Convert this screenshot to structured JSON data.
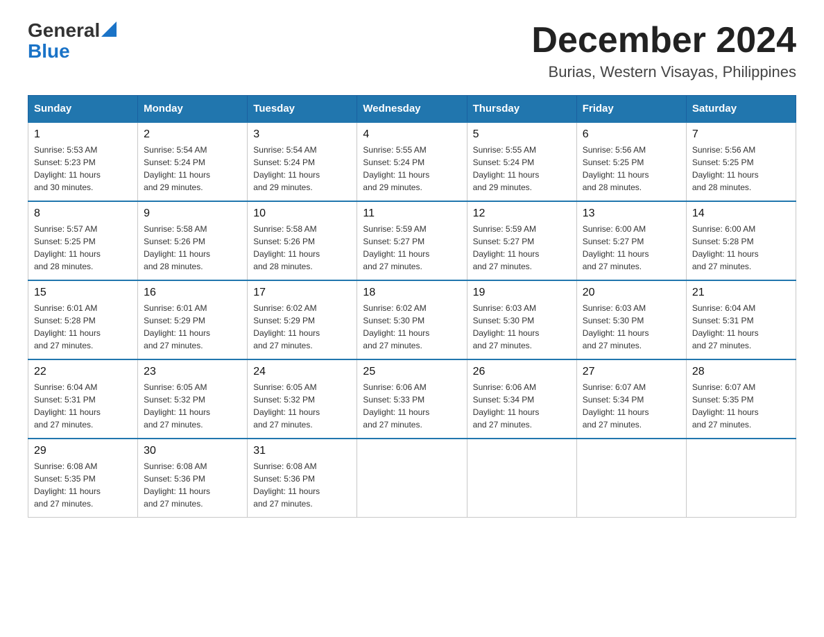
{
  "logo": {
    "general": "General",
    "blue": "Blue"
  },
  "header": {
    "month_year": "December 2024",
    "location": "Burias, Western Visayas, Philippines"
  },
  "days_of_week": [
    "Sunday",
    "Monday",
    "Tuesday",
    "Wednesday",
    "Thursday",
    "Friday",
    "Saturday"
  ],
  "weeks": [
    [
      {
        "day": "1",
        "info": "Sunrise: 5:53 AM\nSunset: 5:23 PM\nDaylight: 11 hours\nand 30 minutes."
      },
      {
        "day": "2",
        "info": "Sunrise: 5:54 AM\nSunset: 5:24 PM\nDaylight: 11 hours\nand 29 minutes."
      },
      {
        "day": "3",
        "info": "Sunrise: 5:54 AM\nSunset: 5:24 PM\nDaylight: 11 hours\nand 29 minutes."
      },
      {
        "day": "4",
        "info": "Sunrise: 5:55 AM\nSunset: 5:24 PM\nDaylight: 11 hours\nand 29 minutes."
      },
      {
        "day": "5",
        "info": "Sunrise: 5:55 AM\nSunset: 5:24 PM\nDaylight: 11 hours\nand 29 minutes."
      },
      {
        "day": "6",
        "info": "Sunrise: 5:56 AM\nSunset: 5:25 PM\nDaylight: 11 hours\nand 28 minutes."
      },
      {
        "day": "7",
        "info": "Sunrise: 5:56 AM\nSunset: 5:25 PM\nDaylight: 11 hours\nand 28 minutes."
      }
    ],
    [
      {
        "day": "8",
        "info": "Sunrise: 5:57 AM\nSunset: 5:25 PM\nDaylight: 11 hours\nand 28 minutes."
      },
      {
        "day": "9",
        "info": "Sunrise: 5:58 AM\nSunset: 5:26 PM\nDaylight: 11 hours\nand 28 minutes."
      },
      {
        "day": "10",
        "info": "Sunrise: 5:58 AM\nSunset: 5:26 PM\nDaylight: 11 hours\nand 28 minutes."
      },
      {
        "day": "11",
        "info": "Sunrise: 5:59 AM\nSunset: 5:27 PM\nDaylight: 11 hours\nand 27 minutes."
      },
      {
        "day": "12",
        "info": "Sunrise: 5:59 AM\nSunset: 5:27 PM\nDaylight: 11 hours\nand 27 minutes."
      },
      {
        "day": "13",
        "info": "Sunrise: 6:00 AM\nSunset: 5:27 PM\nDaylight: 11 hours\nand 27 minutes."
      },
      {
        "day": "14",
        "info": "Sunrise: 6:00 AM\nSunset: 5:28 PM\nDaylight: 11 hours\nand 27 minutes."
      }
    ],
    [
      {
        "day": "15",
        "info": "Sunrise: 6:01 AM\nSunset: 5:28 PM\nDaylight: 11 hours\nand 27 minutes."
      },
      {
        "day": "16",
        "info": "Sunrise: 6:01 AM\nSunset: 5:29 PM\nDaylight: 11 hours\nand 27 minutes."
      },
      {
        "day": "17",
        "info": "Sunrise: 6:02 AM\nSunset: 5:29 PM\nDaylight: 11 hours\nand 27 minutes."
      },
      {
        "day": "18",
        "info": "Sunrise: 6:02 AM\nSunset: 5:30 PM\nDaylight: 11 hours\nand 27 minutes."
      },
      {
        "day": "19",
        "info": "Sunrise: 6:03 AM\nSunset: 5:30 PM\nDaylight: 11 hours\nand 27 minutes."
      },
      {
        "day": "20",
        "info": "Sunrise: 6:03 AM\nSunset: 5:30 PM\nDaylight: 11 hours\nand 27 minutes."
      },
      {
        "day": "21",
        "info": "Sunrise: 6:04 AM\nSunset: 5:31 PM\nDaylight: 11 hours\nand 27 minutes."
      }
    ],
    [
      {
        "day": "22",
        "info": "Sunrise: 6:04 AM\nSunset: 5:31 PM\nDaylight: 11 hours\nand 27 minutes."
      },
      {
        "day": "23",
        "info": "Sunrise: 6:05 AM\nSunset: 5:32 PM\nDaylight: 11 hours\nand 27 minutes."
      },
      {
        "day": "24",
        "info": "Sunrise: 6:05 AM\nSunset: 5:32 PM\nDaylight: 11 hours\nand 27 minutes."
      },
      {
        "day": "25",
        "info": "Sunrise: 6:06 AM\nSunset: 5:33 PM\nDaylight: 11 hours\nand 27 minutes."
      },
      {
        "day": "26",
        "info": "Sunrise: 6:06 AM\nSunset: 5:34 PM\nDaylight: 11 hours\nand 27 minutes."
      },
      {
        "day": "27",
        "info": "Sunrise: 6:07 AM\nSunset: 5:34 PM\nDaylight: 11 hours\nand 27 minutes."
      },
      {
        "day": "28",
        "info": "Sunrise: 6:07 AM\nSunset: 5:35 PM\nDaylight: 11 hours\nand 27 minutes."
      }
    ],
    [
      {
        "day": "29",
        "info": "Sunrise: 6:08 AM\nSunset: 5:35 PM\nDaylight: 11 hours\nand 27 minutes."
      },
      {
        "day": "30",
        "info": "Sunrise: 6:08 AM\nSunset: 5:36 PM\nDaylight: 11 hours\nand 27 minutes."
      },
      {
        "day": "31",
        "info": "Sunrise: 6:08 AM\nSunset: 5:36 PM\nDaylight: 11 hours\nand 27 minutes."
      },
      {
        "day": "",
        "info": ""
      },
      {
        "day": "",
        "info": ""
      },
      {
        "day": "",
        "info": ""
      },
      {
        "day": "",
        "info": ""
      }
    ]
  ]
}
